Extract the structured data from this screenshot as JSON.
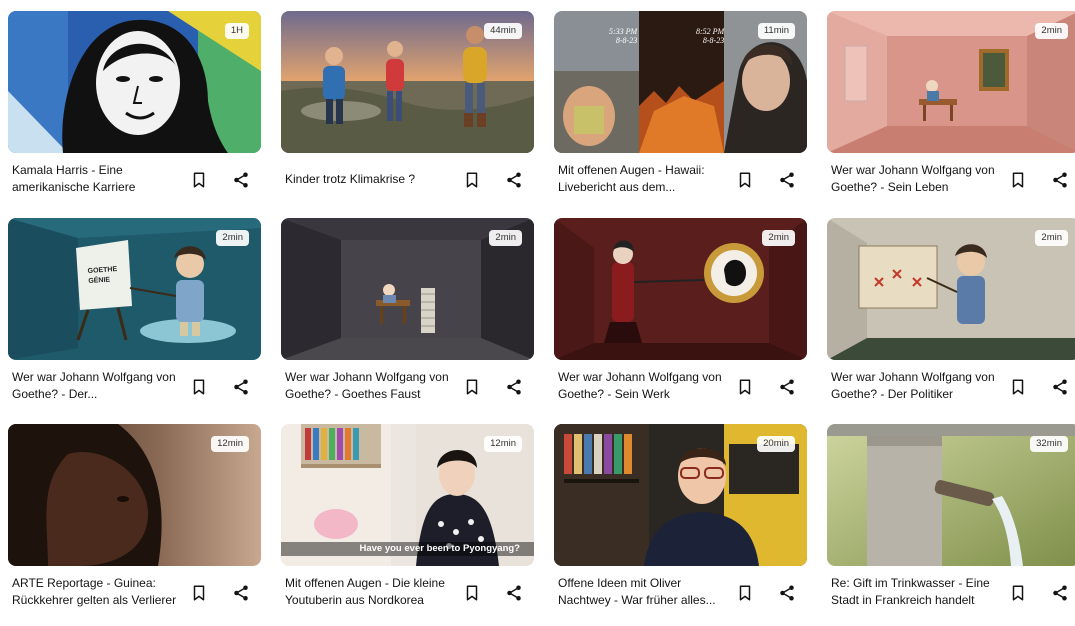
{
  "videos": [
    {
      "title": "Kamala Harris - Eine amerikanische Karriere",
      "duration": "1H"
    },
    {
      "title": "Kinder trotz Klimakrise ?",
      "duration": "44min"
    },
    {
      "title": "Mit offenen Augen - Hawaii: Livebericht aus dem...",
      "duration": "11min",
      "overlay_texts": [
        "5:33 PM",
        "8-8-23",
        "8:52 PM",
        "8-8-23"
      ]
    },
    {
      "title": "Wer war Johann Wolfgang von Goethe? - Sein Leben",
      "duration": "2min"
    },
    {
      "title": "Wer war Johann Wolfgang von Goethe? - Der...",
      "duration": "2min",
      "overlay_texts": [
        "GOETHE",
        "GÉNIE"
      ]
    },
    {
      "title": "Wer war Johann Wolfgang von Goethe? - Goethes Faust",
      "duration": "2min"
    },
    {
      "title": "Wer war Johann Wolfgang von Goethe? - Sein Werk",
      "duration": "2min"
    },
    {
      "title": "Wer war Johann Wolfgang von Goethe? - Der Politiker",
      "duration": "2min"
    },
    {
      "title": "ARTE Reportage - Guinea: Rückkehrer gelten als Verlierer",
      "duration": "12min"
    },
    {
      "title": "Mit offenen Augen - Die kleine Youtuberin aus Nordkorea",
      "duration": "12min",
      "overlay_texts": [
        "Have you ever been to Pyongyang?"
      ]
    },
    {
      "title": "Offene Ideen mit Oliver Nachtwey - War früher alles...",
      "duration": "20min"
    },
    {
      "title": "Re: Gift im Trinkwasser - Eine Stadt in Frankreich handelt",
      "duration": "32min"
    }
  ],
  "icons": {
    "bookmark": "bookmark-icon",
    "share": "share-icon"
  }
}
